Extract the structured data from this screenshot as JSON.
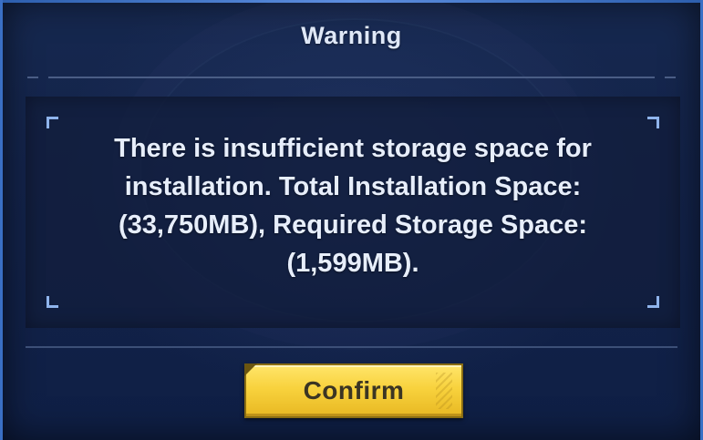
{
  "dialog": {
    "title": "Warning",
    "message": "There is insufficient storage space for installation. Total Installation Space: (33,750MB), Required Storage Space: (1,599MB).",
    "confirm_label": "Confirm"
  },
  "colors": {
    "panel_background": "#13234a",
    "frame_border": "#3a6fc4",
    "confirm_button": "#f8d23d",
    "text": "#e7eefb"
  }
}
